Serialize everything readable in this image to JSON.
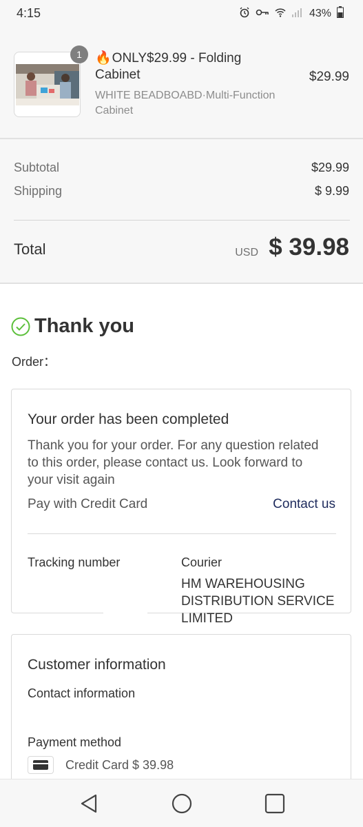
{
  "status_bar": {
    "time": "4:15",
    "battery": "43%",
    "icons": [
      "alarm-icon",
      "key-icon",
      "wifi-icon",
      "signal-icon",
      "battery-icon"
    ]
  },
  "order_summary": {
    "product": {
      "quantity": "1",
      "emoji": "🔥",
      "title": "ONLY$29.99 - Folding Cabinet",
      "variant": "WHITE BEADBOABD·Multi-Function Cabinet",
      "price": "$29.99"
    },
    "subtotal_label": "Subtotal",
    "subtotal_value": "$29.99",
    "shipping_label": "Shipping",
    "shipping_value": "$ 9.99",
    "total_label": "Total",
    "currency": "USD",
    "total_value": "$ 39.98"
  },
  "thank_you": {
    "title": "Thank you",
    "order_label": "Order："
  },
  "order_status_card": {
    "title": "Your order has been completed",
    "message": "Thank you for your order. For any question related to this order, please contact us. Look forward to your visit again",
    "payment_label": "Pay with Credit Card",
    "contact_link": "Contact us",
    "tracking_label": "Tracking number",
    "courier_label": "Courier",
    "courier_name": "HM WAREHOUSING DISTRIBUTION SERVICE LIMITED"
  },
  "customer_card": {
    "title": "Customer information",
    "contact_label": "Contact information",
    "payment_method_label": "Payment method",
    "payment_value": "Credit Card $ 39.98"
  },
  "colors": {
    "accent_check": "#5bbf3a",
    "link": "#1d2a5c",
    "summary_bg": "#f7f7f7"
  }
}
